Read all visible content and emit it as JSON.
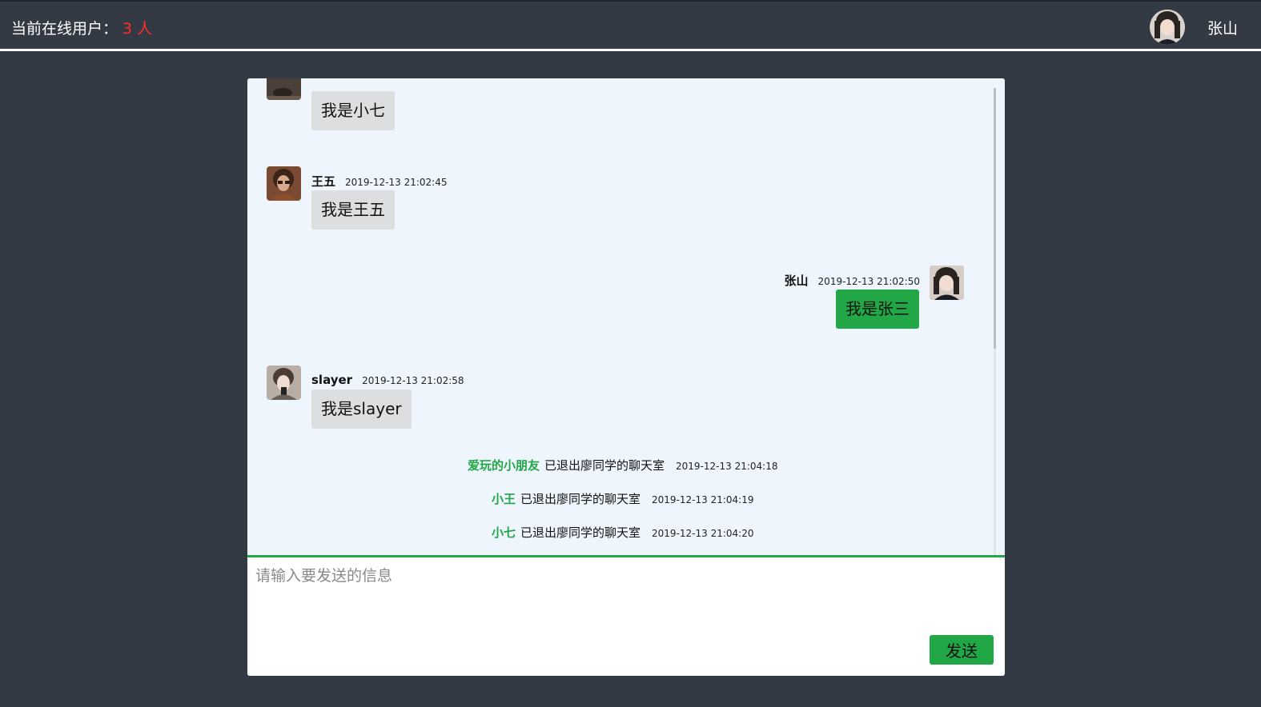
{
  "header": {
    "online_label": "当前在线用户：",
    "online_count": "3 人",
    "current_user": "张山"
  },
  "messages": [
    {
      "name": "",
      "time": "",
      "text": "我是小七",
      "mine": false
    },
    {
      "name": "王五",
      "time": "2019-12-13 21:02:45",
      "text": "我是王五",
      "mine": false
    },
    {
      "name": "张山",
      "time": "2019-12-13 21:02:50",
      "text": "我是张三",
      "mine": true
    },
    {
      "name": "slayer",
      "time": "2019-12-13 21:02:58",
      "text": "我是slayer",
      "mine": false
    }
  ],
  "system_messages": [
    {
      "user": "爱玩的小朋友",
      "text": "已退出廖同学的聊天室",
      "time": "2019-12-13 21:04:18"
    },
    {
      "user": "小王",
      "text": "已退出廖同学的聊天室",
      "time": "2019-12-13 21:04:19"
    },
    {
      "user": "小七",
      "text": "已退出廖同学的聊天室",
      "time": "2019-12-13 21:04:20"
    }
  ],
  "composer": {
    "placeholder": "请输入要发送的信息",
    "send_label": "发送"
  },
  "colors": {
    "accent": "#21a745",
    "count": "#ff2a2a",
    "background": "#343a44",
    "chat_bg": "#eef5fd"
  }
}
